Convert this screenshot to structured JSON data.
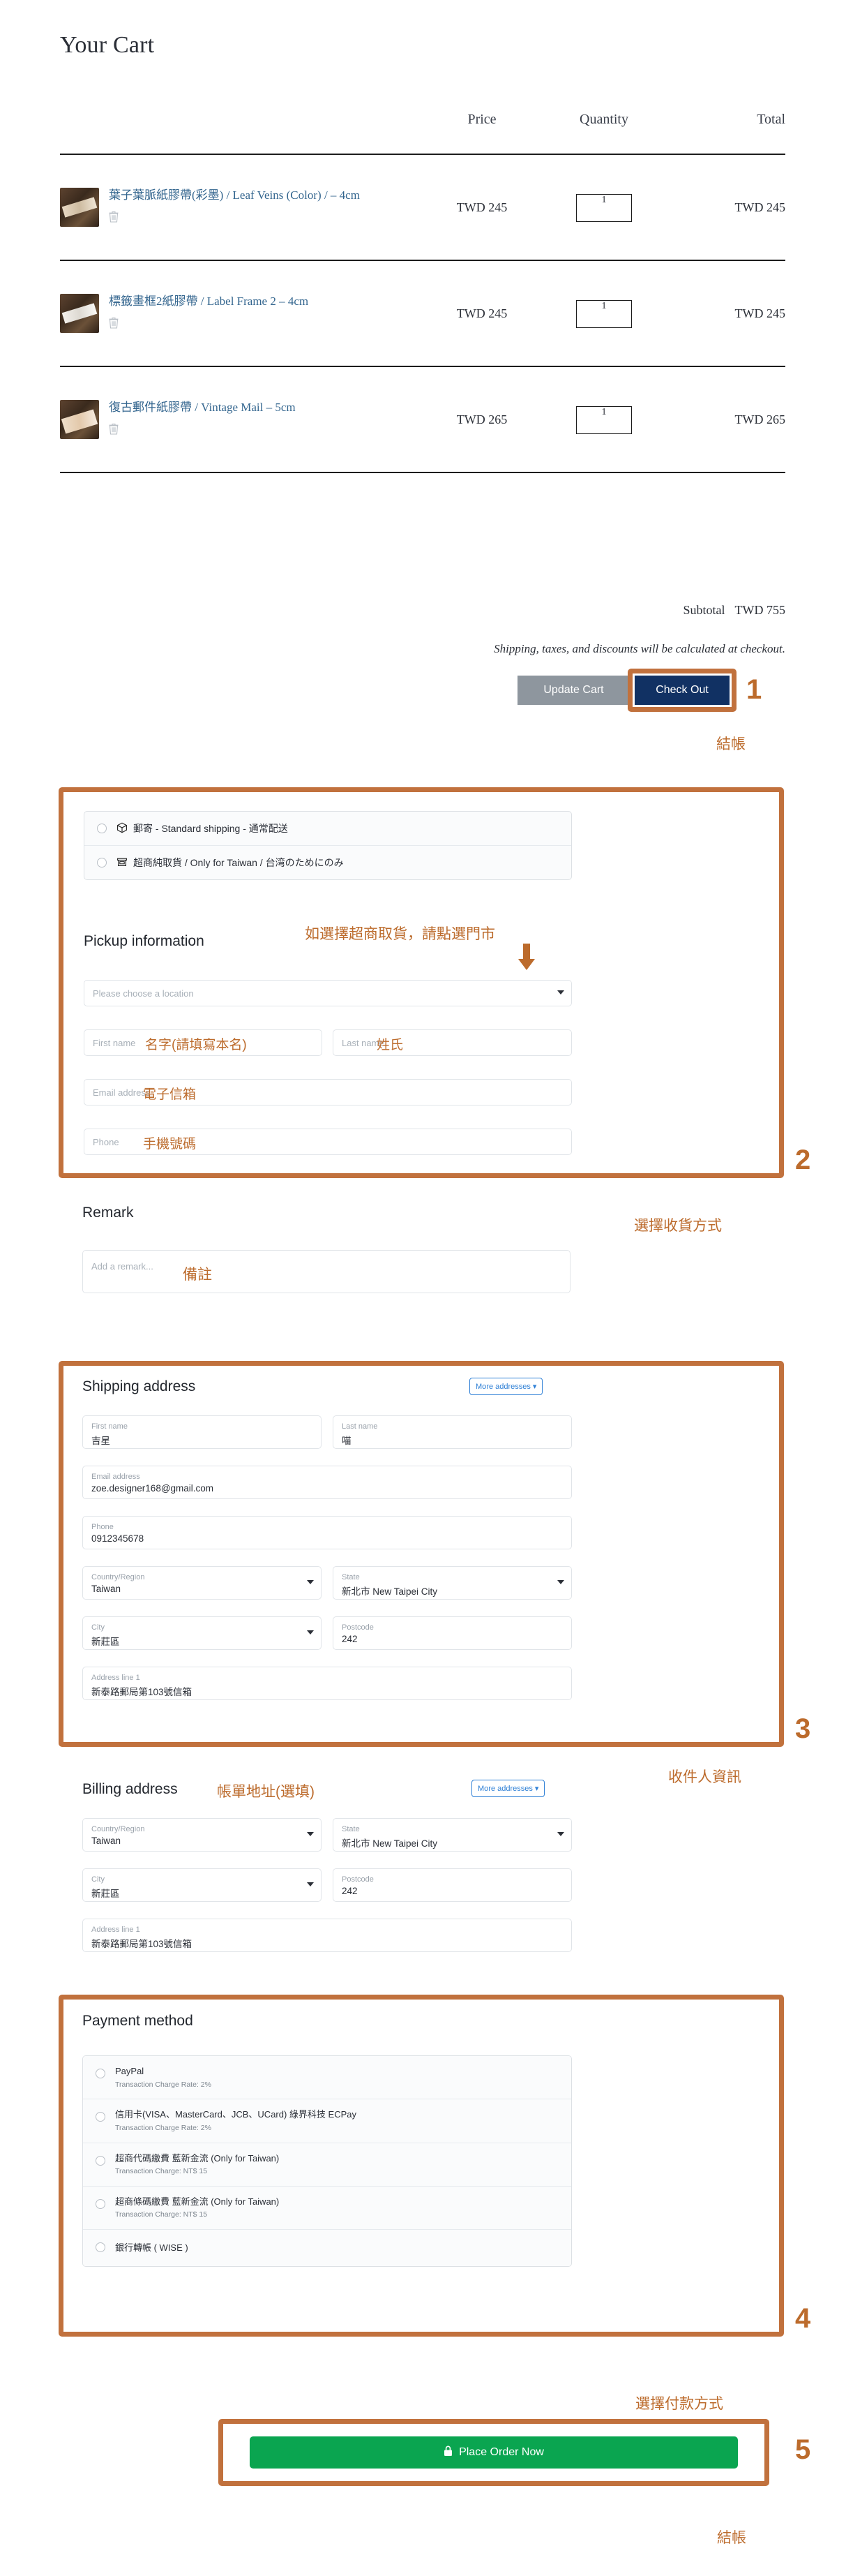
{
  "cart": {
    "title": "Your Cart",
    "columns": {
      "product": "",
      "price": "Price",
      "quantity": "Quantity",
      "total": "Total"
    },
    "items": [
      {
        "name": "葉子葉脈紙膠帶(彩墨) / Leaf Veins (Color) / – 4cm",
        "price": "TWD 245",
        "quantity": "1",
        "total": "TWD 245",
        "remove_icon": "trash-icon"
      },
      {
        "name": "標籤畫框2紙膠帶 / Label Frame 2 – 4cm",
        "price": "TWD 245",
        "quantity": "1",
        "total": "TWD 245",
        "remove_icon": "trash-icon"
      },
      {
        "name": "復古郵件紙膠帶 / Vintage Mail – 5cm",
        "price": "TWD 265",
        "quantity": "1",
        "total": "TWD 265",
        "remove_icon": "trash-icon"
      }
    ],
    "subtotal_label": "Subtotal",
    "subtotal_value": "TWD 755",
    "shipping_note": "Shipping, taxes, and discounts will be calculated at checkout.",
    "update_cart_label": "Update Cart",
    "checkout_label": "Check Out"
  },
  "shipping_method": {
    "options": [
      {
        "label": "郵寄 - Standard shipping - 通常配送",
        "icon": "package-icon"
      },
      {
        "label": "超商純取貨 / Only for Taiwan / 台湾のためにのみ",
        "icon": "store-icon"
      }
    ]
  },
  "pickup": {
    "title": "Pickup information",
    "location_placeholder": "Please choose a location",
    "first_name_label": "First name",
    "last_name_label": "Last name",
    "email_label": "Email address",
    "phone_label": "Phone"
  },
  "remark": {
    "title": "Remark",
    "placeholder": "Add a remark..."
  },
  "shipping_address": {
    "title": "Shipping address",
    "more_addresses_label": "More addresses",
    "fields": [
      {
        "label": "First name",
        "value": "吉星"
      },
      {
        "label": "Last name",
        "value": "喵"
      },
      {
        "label": "Email address",
        "value": "zoe.designer168@gmail.com"
      },
      {
        "label": "Phone",
        "value": "0912345678"
      },
      {
        "label": "Country/Region",
        "value": "Taiwan"
      },
      {
        "label": "State",
        "value": "新北市 New Taipei City"
      },
      {
        "label": "City",
        "value": "新莊區"
      },
      {
        "label": "Postcode",
        "value": "242"
      },
      {
        "label": "Address line 1",
        "value": "新泰路郵局第103號信箱"
      }
    ]
  },
  "billing_address": {
    "title": "Billing address",
    "more_addresses_label": "More addresses",
    "fields": [
      {
        "label": "Country/Region",
        "value": "Taiwan"
      },
      {
        "label": "State",
        "value": "新北市 New Taipei City"
      },
      {
        "label": "City",
        "value": "新莊區"
      },
      {
        "label": "Postcode",
        "value": "242"
      },
      {
        "label": "Address line 1",
        "value": "新泰路郵局第103號信箱"
      }
    ]
  },
  "payment": {
    "title": "Payment method",
    "options": [
      {
        "name": "PayPal",
        "note": "Transaction Charge Rate: 2%"
      },
      {
        "name": "信用卡(VISA、MasterCard、JCB、UCard) 綠界科技 ECPay",
        "note": "Transaction Charge Rate: 2%"
      },
      {
        "name": "超商代碼繳費 藍新金流 (Only for Taiwan)",
        "note": "Transaction Charge: NT$ 15"
      },
      {
        "name": "超商條碼繳費 藍新金流 (Only for Taiwan)",
        "note": "Transaction Charge: NT$ 15"
      },
      {
        "name": "銀行轉帳 ( WISE )",
        "note": ""
      }
    ]
  },
  "place_order": {
    "label": "Place Order Now",
    "icon": "lock-icon"
  },
  "annotations": {
    "accent_color": "#bc6b2c",
    "step1_num": "1",
    "step1_text": "結帳",
    "step2_num": "2",
    "step2_text": "選擇收貨方式",
    "step3_num": "3",
    "step3_text": "收件人資訊",
    "step4_num": "4",
    "step4_text": "選擇付款方式",
    "step5_num": "5",
    "step5_text": "結帳",
    "pickup_hint": "如選擇超商取貨，請點選門市",
    "first_name_hint": "名字(請填寫本名)",
    "last_name_hint": "姓氏",
    "email_hint": "電子信箱",
    "phone_hint": "手機號碼",
    "remark_hint": "備註",
    "billing_hint": "帳單地址(選填)"
  }
}
